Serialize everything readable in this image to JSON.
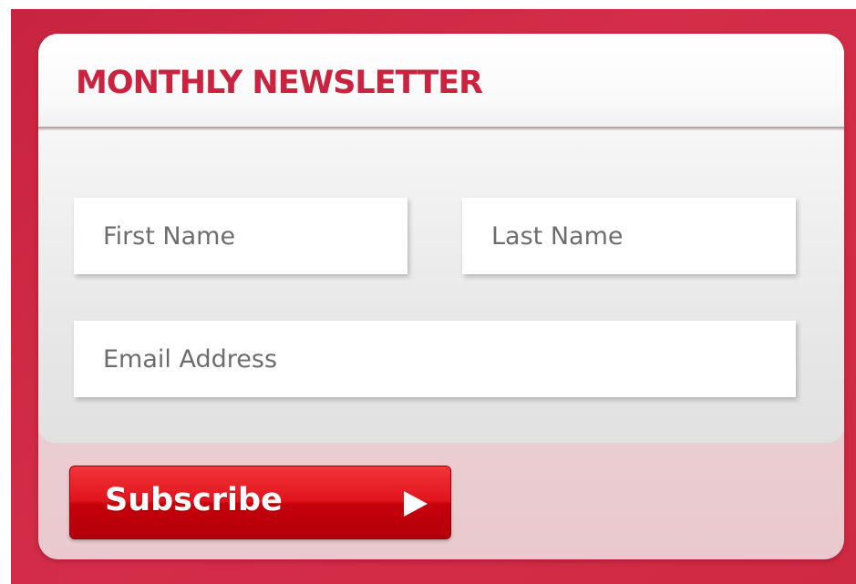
{
  "newsletter": {
    "title": "MONTHLY NEWSLETTER",
    "fields": {
      "first_name": {
        "placeholder": "First Name",
        "value": ""
      },
      "last_name": {
        "placeholder": "Last Name",
        "value": ""
      },
      "email": {
        "placeholder": "Email Address",
        "value": ""
      }
    },
    "subscribe_label": "Subscribe",
    "subscribe_icon": "play-arrow-icon"
  },
  "colors": {
    "brand_red": "#c8243f",
    "button_red": "#e0141c"
  }
}
